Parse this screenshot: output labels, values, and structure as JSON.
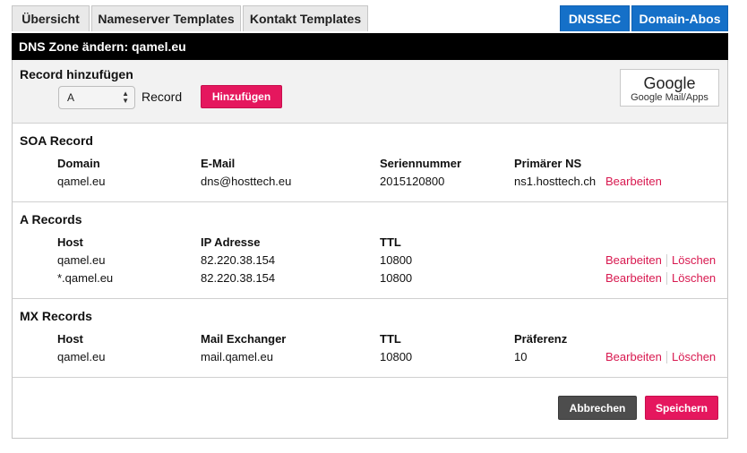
{
  "tabs": [
    "Übersicht",
    "Nameserver Templates",
    "Kontakt Templates"
  ],
  "top_buttons": {
    "dnssec": "DNSSEC",
    "domain_abos": "Domain-Abos"
  },
  "title": "DNS Zone ändern: qamel.eu",
  "add_record": {
    "label": "Record hinzufügen",
    "type_value": "A",
    "record_label": "Record",
    "add_button": "Hinzufügen",
    "google_title": "Google",
    "google_subtitle": "Google Mail/Apps"
  },
  "soa": {
    "title": "SOA Record",
    "headers": [
      "Domain",
      "E-Mail",
      "Seriennummer",
      "Primärer NS"
    ],
    "row": [
      "qamel.eu",
      "dns@hosttech.eu",
      "2015120800",
      "ns1.hosttech.ch"
    ],
    "edit": "Bearbeiten"
  },
  "a_records": {
    "title": "A Records",
    "headers": [
      "Host",
      "IP Adresse",
      "TTL"
    ],
    "rows": [
      [
        "qamel.eu",
        "82.220.38.154",
        "10800"
      ],
      [
        "*.qamel.eu",
        "82.220.38.154",
        "10800"
      ]
    ],
    "edit": "Bearbeiten",
    "delete": "Löschen"
  },
  "mx_records": {
    "title": "MX Records",
    "headers": [
      "Host",
      "Mail Exchanger",
      "TTL",
      "Präferenz"
    ],
    "rows": [
      [
        "qamel.eu",
        "mail.qamel.eu",
        "10800",
        "10"
      ]
    ],
    "edit": "Bearbeiten",
    "delete": "Löschen"
  },
  "footer": {
    "cancel": "Abbrechen",
    "save": "Speichern"
  },
  "colors": {
    "accent": "#e5175e",
    "link": "#d8184f",
    "blue": "#1570c8",
    "title_bar": "#000000"
  }
}
